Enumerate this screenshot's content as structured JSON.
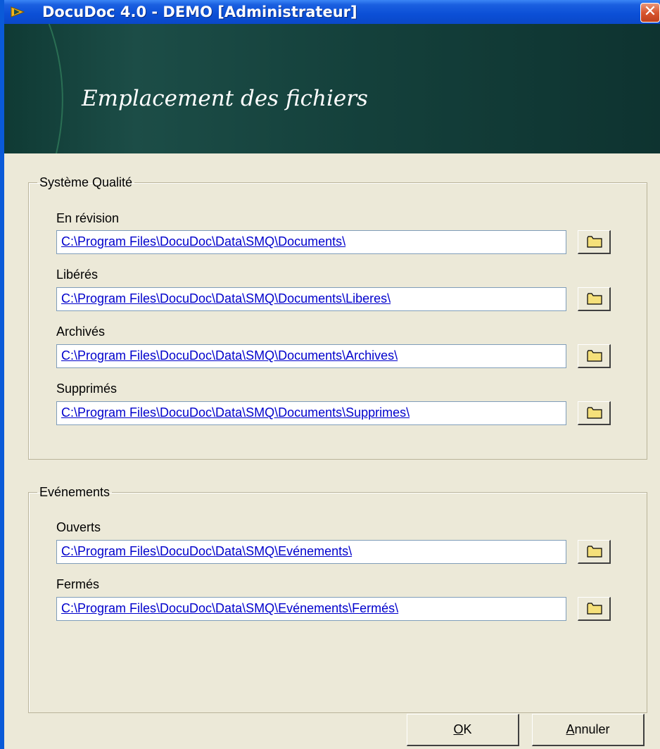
{
  "window": {
    "title": "DocuDoc 4.0 - DEMO [Administrateur]",
    "close_glyph": "✕",
    "icon": "docudoc-app-icon"
  },
  "banner": {
    "title": "Emplacement des fichiers"
  },
  "groups": [
    {
      "legend": "Système Qualité",
      "fields": [
        {
          "label": "En révision",
          "path": "C:\\Program Files\\DocuDoc\\Data\\SMQ\\Documents\\"
        },
        {
          "label": "Libérés",
          "path": "C:\\Program Files\\DocuDoc\\Data\\SMQ\\Documents\\Liberes\\"
        },
        {
          "label": "Archivés",
          "path": "C:\\Program Files\\DocuDoc\\Data\\SMQ\\Documents\\Archives\\"
        },
        {
          "label": "Supprimés",
          "path": "C:\\Program Files\\DocuDoc\\Data\\SMQ\\Documents\\Supprimes\\"
        }
      ]
    },
    {
      "legend": "Evénements",
      "fields": [
        {
          "label": "Ouverts",
          "path": "C:\\Program Files\\DocuDoc\\Data\\SMQ\\Evénements\\"
        },
        {
          "label": "Fermés",
          "path": "C:\\Program Files\\DocuDoc\\Data\\SMQ\\Evénements\\Fermés\\"
        }
      ]
    }
  ],
  "buttons": {
    "ok_mnemonic": "O",
    "ok_rest": "K",
    "cancel_mnemonic": "A",
    "cancel_rest": "nnuler"
  },
  "colors": {
    "titlebar": "#0a48c8",
    "banner": "#1c4d47",
    "path_link": "#0000cc",
    "folder": "#f5e07a"
  }
}
